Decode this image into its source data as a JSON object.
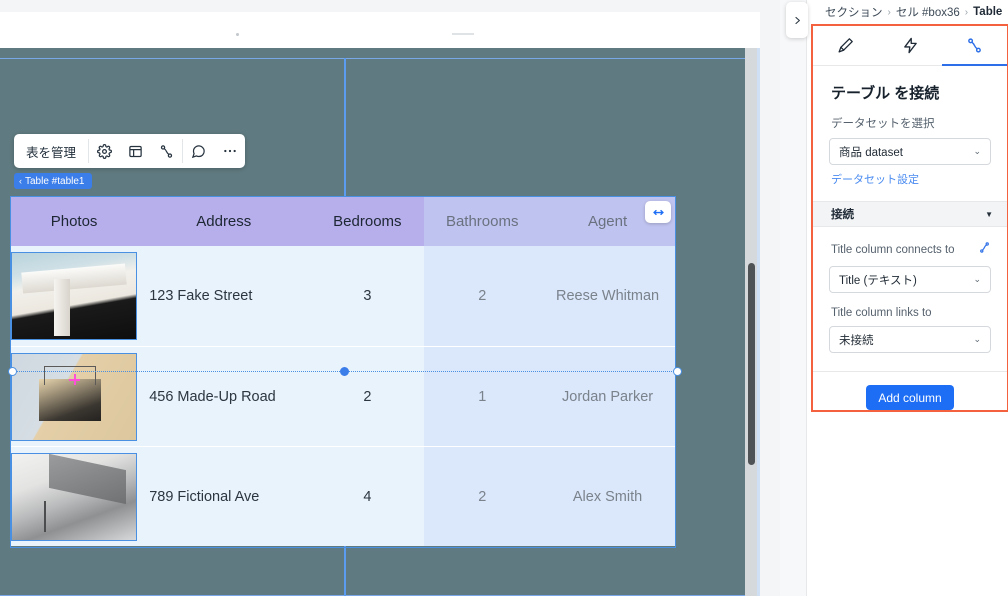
{
  "canvas": {
    "toolbar": {
      "manage_label": "表を管理",
      "buttons": [
        {
          "name": "gear-icon",
          "label": "設定"
        },
        {
          "name": "layout-icon",
          "label": "レイアウト"
        },
        {
          "name": "connect-icon",
          "label": "接続"
        },
        {
          "name": "comment-icon",
          "label": "コメント"
        },
        {
          "name": "more-icon",
          "label": "その他"
        }
      ]
    },
    "badge": {
      "chevron": "‹",
      "label": "Table #table1"
    },
    "resize_handle": "resize-width-handle"
  },
  "table": {
    "headers": [
      "Photos",
      "Address",
      "Bedrooms",
      "Bathrooms",
      "Agent"
    ],
    "rows": [
      {
        "photo": "house-photo-1",
        "address": "123 Fake Street",
        "bedrooms": "3",
        "bathrooms": "2",
        "agent": "Reese Whitman"
      },
      {
        "photo": "house-photo-2",
        "address": "456 Made-Up Road",
        "bedrooms": "2",
        "bathrooms": "1",
        "agent": "Jordan Parker"
      },
      {
        "photo": "house-photo-3",
        "address": "789 Fictional Ave",
        "bedrooms": "4",
        "bathrooms": "2",
        "agent": "Alex Smith"
      }
    ]
  },
  "panel": {
    "breadcrumb": [
      "セクション",
      "セル #box36",
      "Table"
    ],
    "breadcrumb_sep": "›",
    "tabs": [
      {
        "name": "design-tab",
        "icon": "paintbrush-icon",
        "active": false
      },
      {
        "name": "interactions-tab",
        "icon": "lightning-icon",
        "active": false
      },
      {
        "name": "connect-tab",
        "icon": "connector-icon",
        "active": true
      }
    ],
    "title": "テーブル を接続",
    "dataset_label": "データセットを選択",
    "dataset_value": "商品 dataset",
    "dataset_settings_link": "データセット設定",
    "section_header": "接続",
    "section_caret": "▼",
    "connects_to_label": "Title column connects to",
    "connects_to_value": "Title (テキスト)",
    "links_to_label": "Title column links to",
    "links_to_value": "未接続",
    "add_column_label": "Add column",
    "caret": "⌄",
    "toggle_icon": "❯"
  },
  "colors": {
    "accent_blue": "#1d6ef5",
    "highlight_orange": "#f4613f",
    "selection_blue": "#4a90e2",
    "header_purple_left": "#b7aeec",
    "header_purple_right": "#bfc3ef",
    "cell_left": "#e8f3fc",
    "cell_right": "#dbe8fb",
    "section_teal": "#5f7a80"
  }
}
